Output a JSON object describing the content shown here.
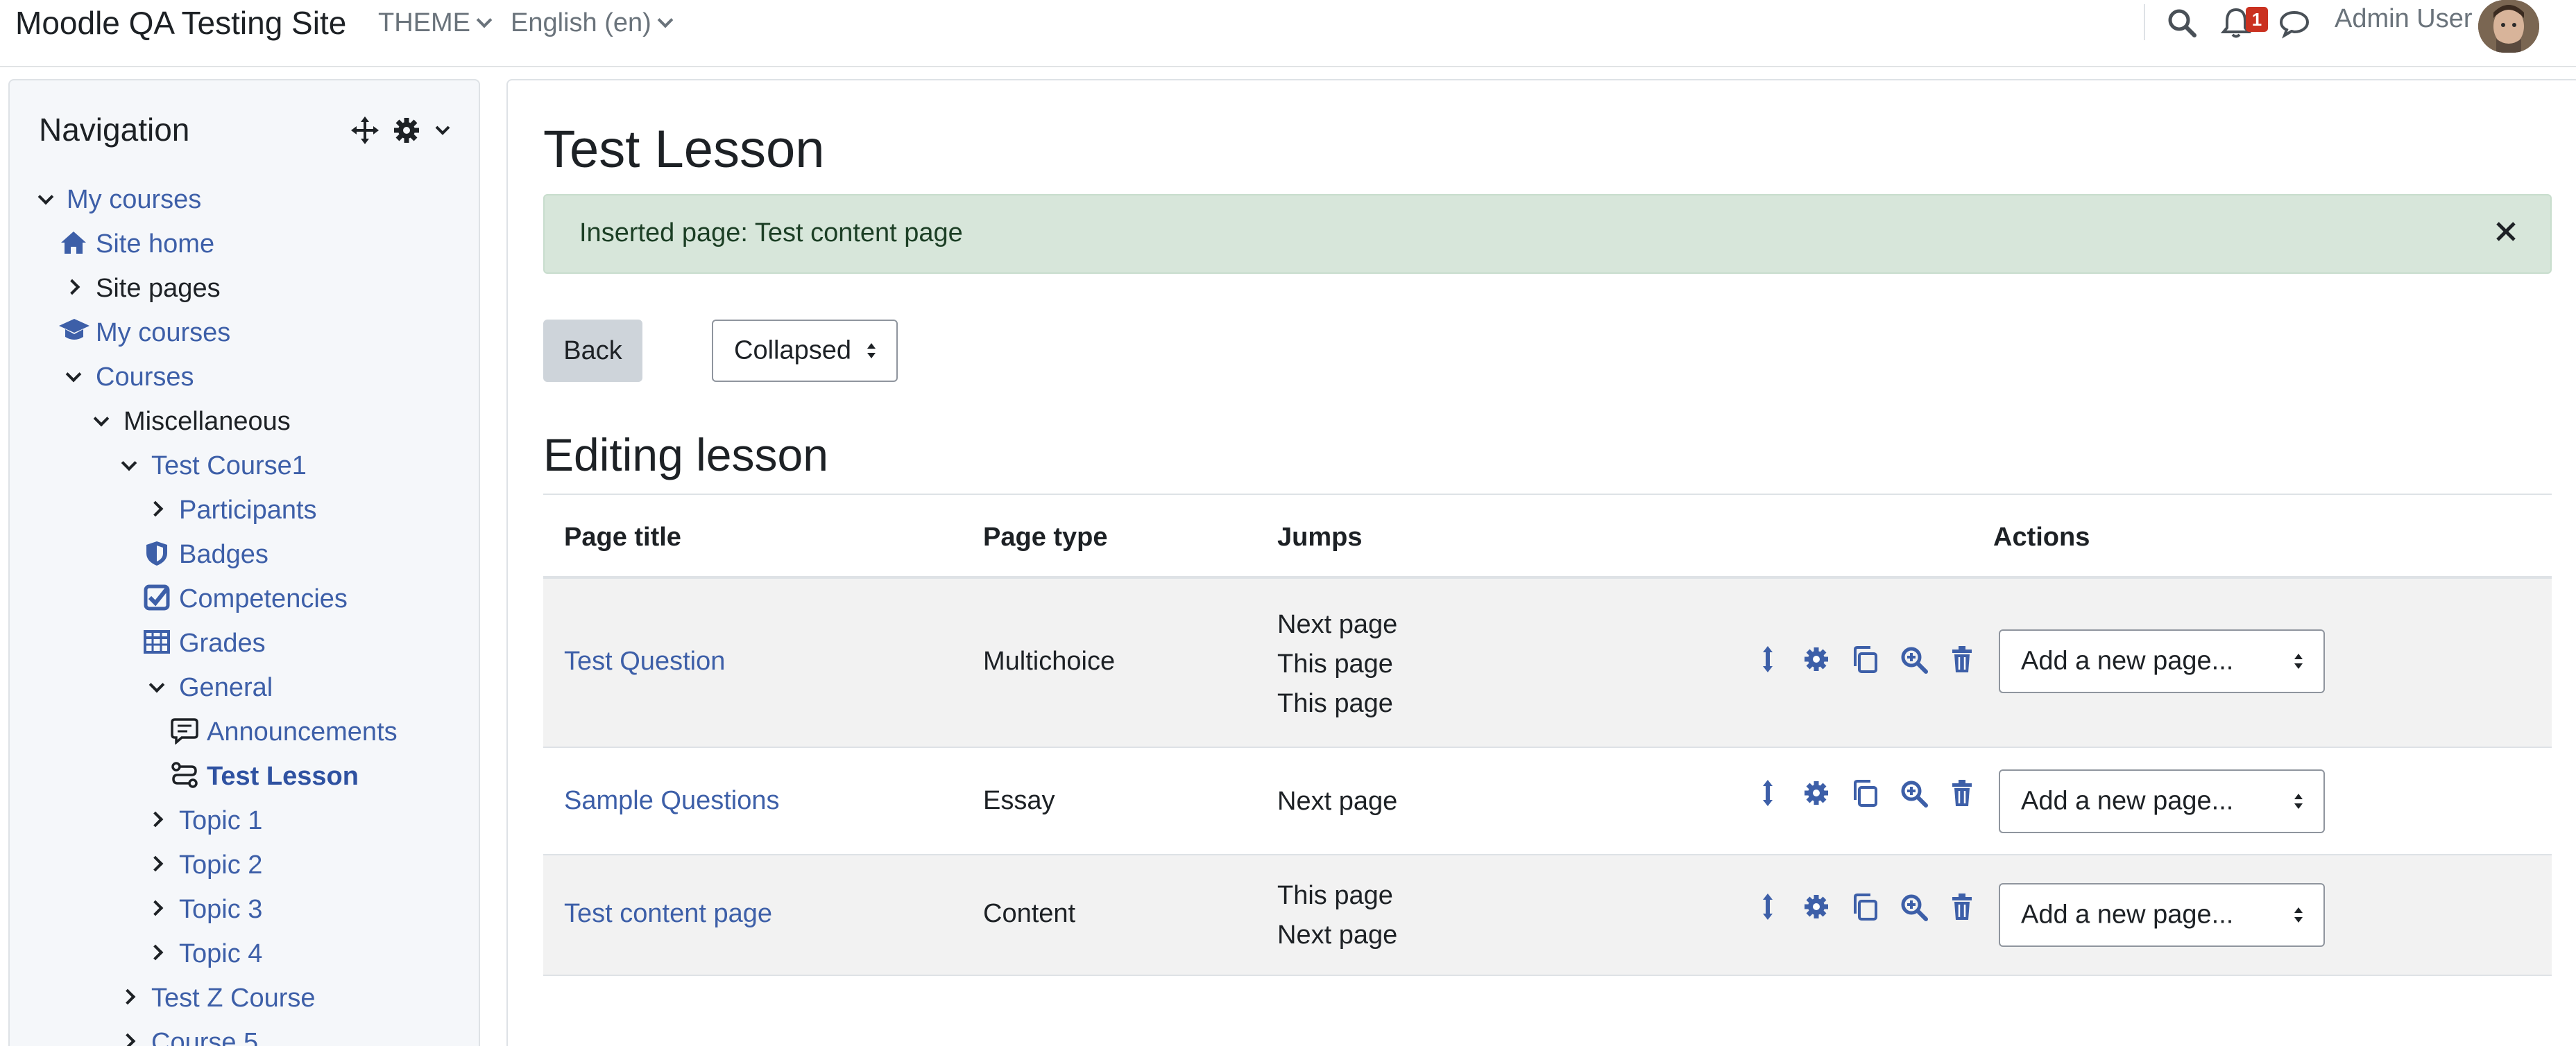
{
  "header": {
    "site_name": "Moodle QA Testing Site",
    "theme_menu": "THEME",
    "language_menu": "English (en)",
    "notification_count": "1",
    "user_name": "Admin User"
  },
  "navigation": {
    "title": "Navigation",
    "items": [
      {
        "label": "My courses"
      },
      {
        "label": "Site home"
      },
      {
        "label": "Site pages"
      },
      {
        "label": "My courses"
      },
      {
        "label": "Courses"
      },
      {
        "label": "Miscellaneous"
      },
      {
        "label": "Test Course1"
      },
      {
        "label": "Participants"
      },
      {
        "label": "Badges"
      },
      {
        "label": "Competencies"
      },
      {
        "label": "Grades"
      },
      {
        "label": "General"
      },
      {
        "label": "Announcements"
      },
      {
        "label": "Test Lesson"
      },
      {
        "label": "Topic 1"
      },
      {
        "label": "Topic 2"
      },
      {
        "label": "Topic 3"
      },
      {
        "label": "Topic 4"
      },
      {
        "label": "Test Z Course"
      },
      {
        "label": "Course 5"
      }
    ]
  },
  "main": {
    "page_title": "Test Lesson",
    "alert_text": "Inserted page: Test content page",
    "back_label": "Back",
    "view_select": "Collapsed",
    "section_title": "Editing lesson",
    "table": {
      "headers": [
        "Page title",
        "Page type",
        "Jumps",
        "Actions"
      ],
      "rows": [
        {
          "title": "Test Question",
          "type": "Multichoice",
          "jumps": [
            "Next page",
            "This page",
            "This page"
          ],
          "add_page": "Add a new page..."
        },
        {
          "title": "Sample Questions",
          "type": "Essay",
          "jumps": [
            "Next page"
          ],
          "add_page": "Add a new page..."
        },
        {
          "title": "Test content page",
          "type": "Content",
          "jumps": [
            "This page",
            "Next page"
          ],
          "add_page": "Add a new page..."
        }
      ]
    }
  },
  "colors": {
    "link": "#3d5fa8",
    "alert_bg": "#d7e6da",
    "badge": "#ca3120"
  },
  "icons": [
    "search-icon",
    "bell-icon",
    "chat-icon",
    "move-icon",
    "gear-icon",
    "home-icon",
    "graduation-cap-icon",
    "shield-icon",
    "check-square-icon",
    "table-icon",
    "forum-icon",
    "lesson-icon",
    "close-icon",
    "move-arrows-icon",
    "edit-gear-icon",
    "copy-icon",
    "zoom-icon",
    "trash-icon"
  ]
}
